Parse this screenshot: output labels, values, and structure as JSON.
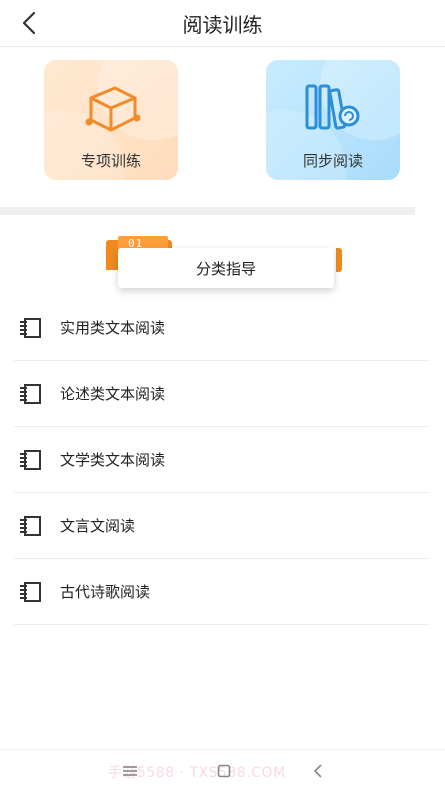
{
  "header": {
    "title": "阅读训练"
  },
  "cards": [
    {
      "label": "专项训练",
      "icon": "cube-icon"
    },
    {
      "label": "同步阅读",
      "icon": "books-icon"
    }
  ],
  "section": {
    "badge_number": "01",
    "title": "分类指导"
  },
  "items": [
    {
      "label": "实用类文本阅读"
    },
    {
      "label": "论述类文本阅读"
    },
    {
      "label": "文学类文本阅读"
    },
    {
      "label": "文言文阅读"
    },
    {
      "label": "古代诗歌阅读"
    }
  ],
  "watermark": "手游5588 · TXS588.COM",
  "colors": {
    "accent": "#f08a1f",
    "card_left": "#ffdcbc",
    "card_right": "#a9dcfb"
  }
}
